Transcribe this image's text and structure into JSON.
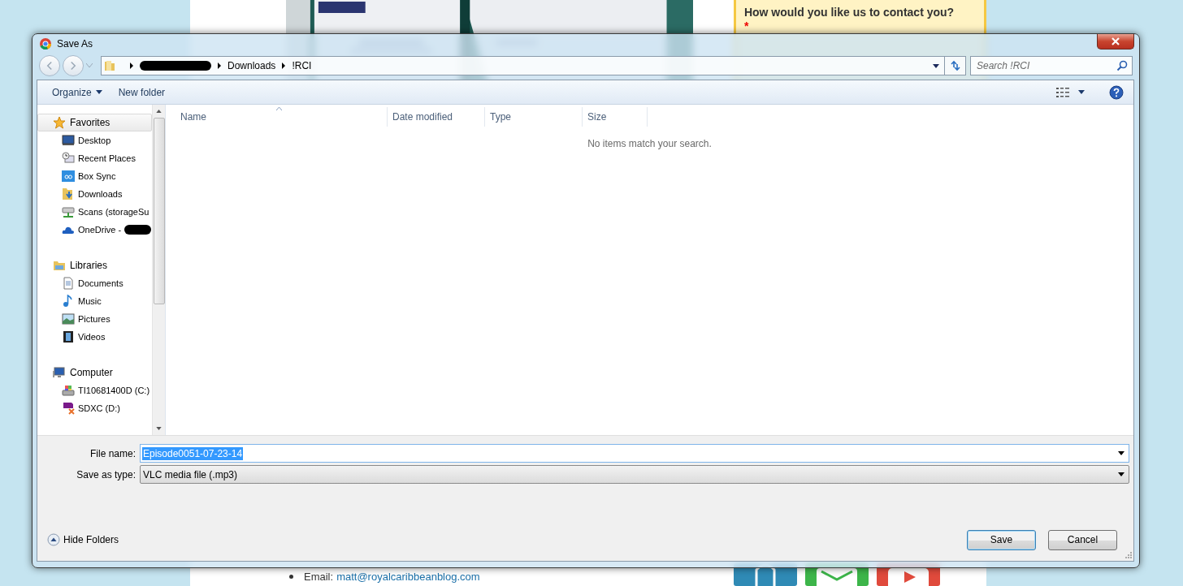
{
  "background_page": {
    "contact_form": {
      "heading": "How would you like us to contact you?",
      "required_mark": "*"
    },
    "email_item": {
      "label": "Email:",
      "link": "matt@royalcaribbeanblog.com"
    }
  },
  "window": {
    "title": "Save As"
  },
  "address_bar": {
    "crumbs": [
      {
        "redacted": true
      },
      {
        "label": "Downloads",
        "redacted": false
      },
      {
        "label": "!RCI",
        "redacted": false
      }
    ]
  },
  "search": {
    "placeholder": "Search !RCI"
  },
  "toolbar": {
    "buttons": [
      {
        "label": "Organize",
        "menu": true
      },
      {
        "label": "New folder",
        "menu": false
      }
    ]
  },
  "nav_pane": {
    "groups": [
      {
        "label": "Favorites",
        "kind": "favorites",
        "selected": true,
        "children": [
          {
            "label": "Desktop",
            "kind": "desktop",
            "selected": false,
            "redacted": false
          },
          {
            "label": "Recent Places",
            "kind": "recent",
            "selected": false,
            "redacted": false
          },
          {
            "label": "Box Sync",
            "kind": "box",
            "selected": false,
            "redacted": false
          },
          {
            "label": "Downloads",
            "kind": "downloads",
            "selected": false,
            "redacted": false
          },
          {
            "label": "Scans (storageSu",
            "kind": "network",
            "selected": false,
            "redacted": false
          },
          {
            "label": "OneDrive -",
            "kind": "cloud",
            "selected": false,
            "redacted": true
          }
        ]
      },
      {
        "label": "Libraries",
        "kind": "libraries",
        "selected": false,
        "children": [
          {
            "label": "Documents",
            "kind": "documents",
            "selected": false,
            "redacted": false
          },
          {
            "label": "Music",
            "kind": "music",
            "selected": false,
            "redacted": false
          },
          {
            "label": "Pictures",
            "kind": "pictures",
            "selected": false,
            "redacted": false
          },
          {
            "label": "Videos",
            "kind": "videos",
            "selected": false,
            "redacted": false
          }
        ]
      },
      {
        "label": "Computer",
        "kind": "computer",
        "selected": false,
        "children": [
          {
            "label": "TI10681400D (C:)",
            "kind": "drive",
            "selected": false,
            "redacted": false
          },
          {
            "label": "SDXC (D:)",
            "kind": "sd",
            "selected": false,
            "redacted": false
          }
        ]
      }
    ]
  },
  "file_list": {
    "columns": [
      {
        "label": "Name",
        "sorted": true
      },
      {
        "label": "Date modified",
        "sorted": false
      },
      {
        "label": "Type",
        "sorted": false
      },
      {
        "label": "Size",
        "sorted": false
      }
    ],
    "empty_message": "No items match your search."
  },
  "file_name": {
    "label": "File name:",
    "value": "Episode0051-07-23-14",
    "value_selected": true
  },
  "save_as_type": {
    "label": "Save as type:",
    "value": "VLC media file (.mp3)"
  },
  "hide_folders": "Hide Folders",
  "buttons": [
    {
      "label": "Save",
      "default": true
    },
    {
      "label": "Cancel",
      "default": false
    }
  ]
}
